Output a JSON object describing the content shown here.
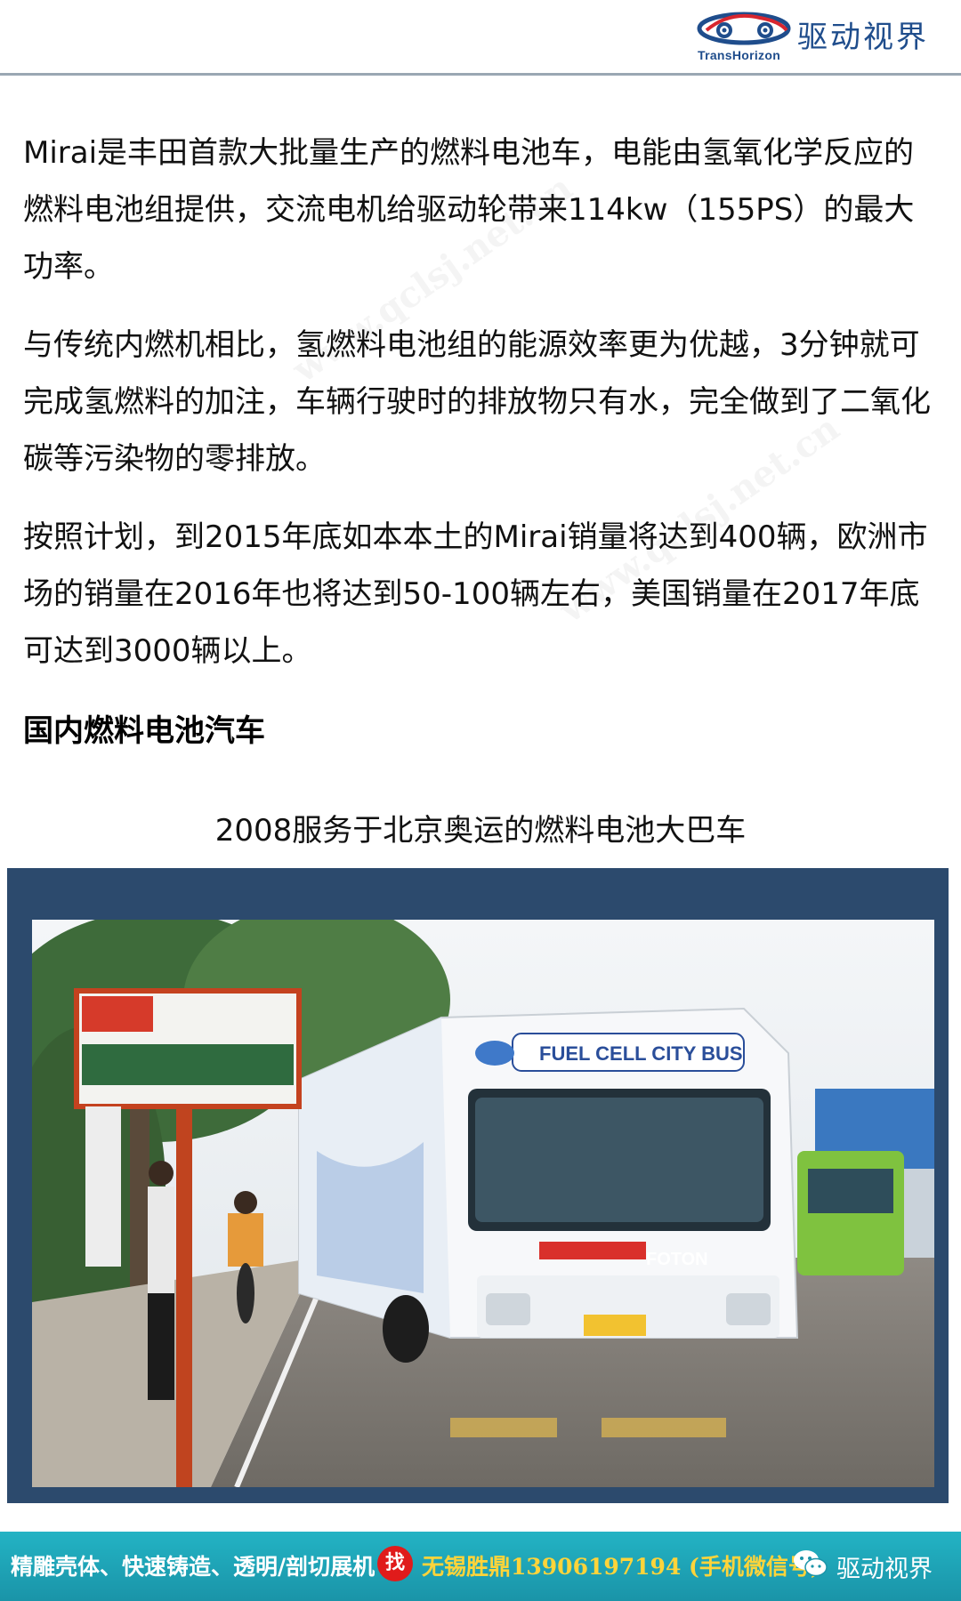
{
  "header": {
    "logo_sub": "TransHorizon",
    "logo_cn": "驱动视界"
  },
  "article": {
    "paragraphs": [
      "Mirai是丰田首款大批量生产的燃料电池车，电能由氢氧化学反应的燃料电池组提供，交流电机给驱动轮带来114kw（155PS）的最大功率。",
      "与传统内燃机相比，氢燃料电池组的能源效率更为优越，3分钟就可完成氢燃料的加注，车辆行驶时的排放物只有水，完全做到了二氧化碳等污染物的零排放。",
      "按照计划，到2015年底如本本土的Mirai销量将达到400辆，欧洲市场的销量在2016年也将达到50-100辆左右，美国销量在2017年底可达到3000辆以上。"
    ],
    "heading": "国内燃料电池汽车",
    "caption": "2008服务于北京奥运的燃料电池大巴车"
  },
  "photo": {
    "bus_banner": "FUEL CELL CITY BUS",
    "bus_brand": "FOTON"
  },
  "watermark": "www.qclsj.net.cn",
  "footer": {
    "services": "精雕壳体、快速铸造、透明/剖切展机",
    "find_badge": "找",
    "contact": "无锡胜鼎13906197194 (手机微信号)",
    "brand": "驱动视界"
  },
  "colors": {
    "brand_blue": "#1f4d8c",
    "footer_teal": "#1fa6b8",
    "badge_red": "#e01b1b",
    "contact_yellow": "#ffd43a",
    "frame_navy": "#2c4a6d"
  }
}
